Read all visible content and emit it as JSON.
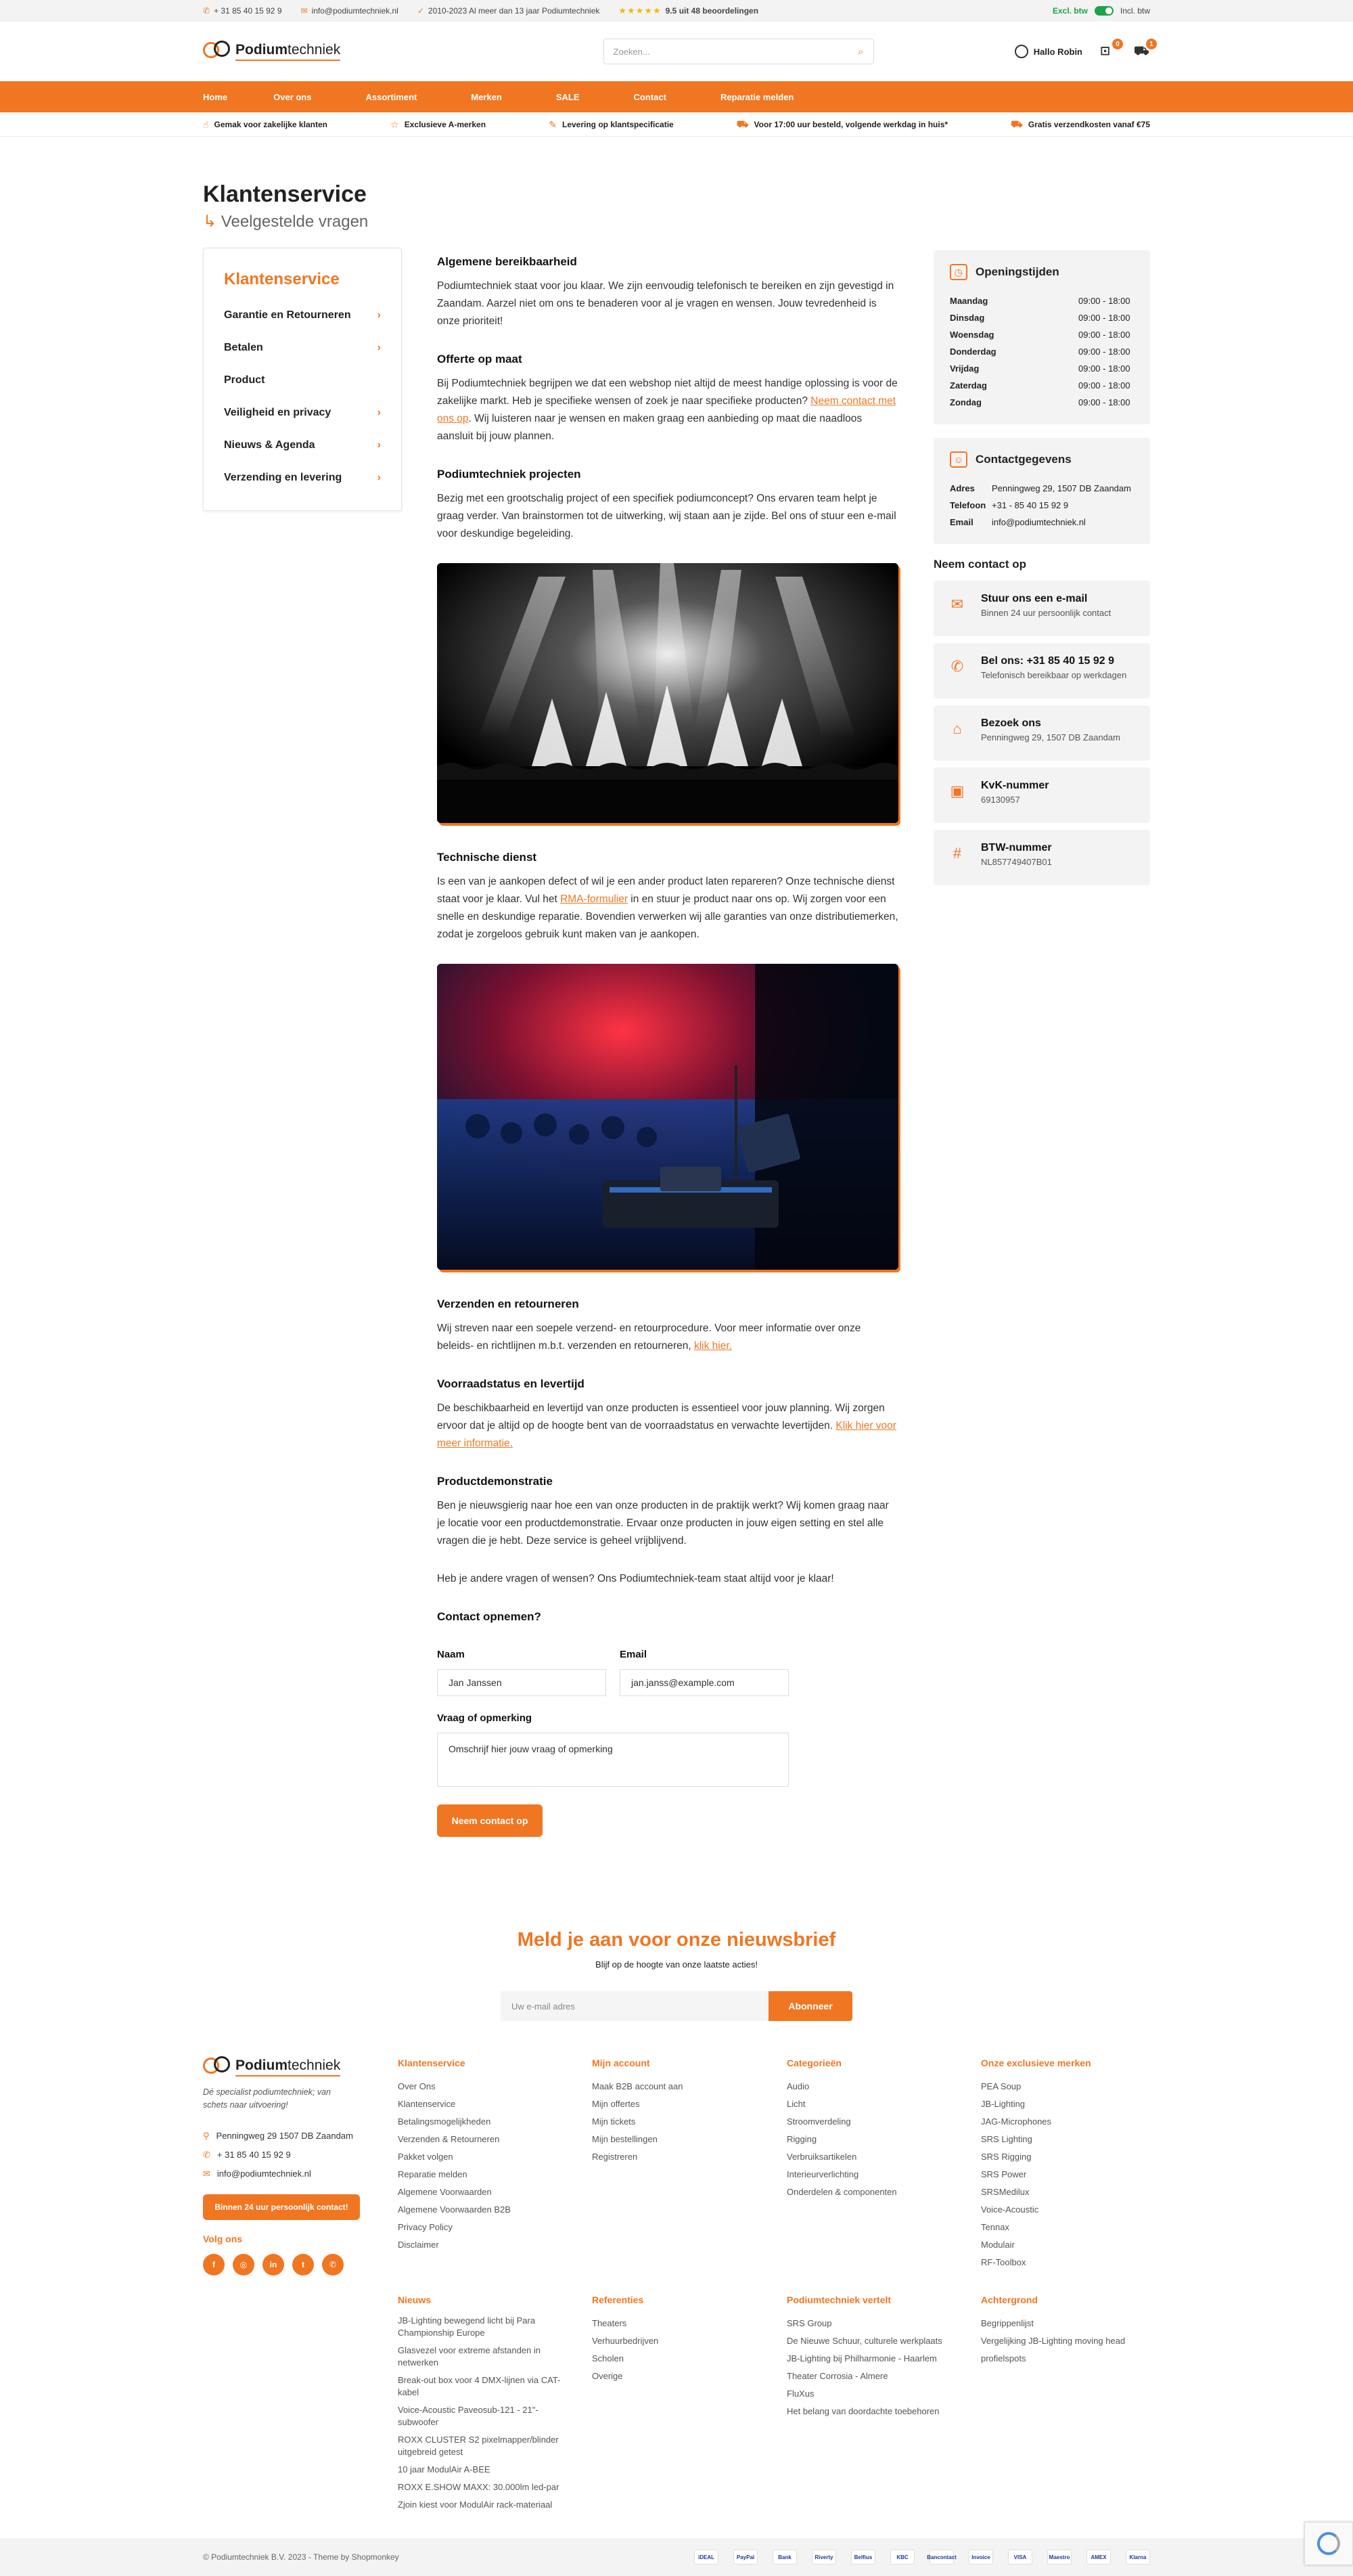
{
  "topbar": {
    "phone": "+ 31 85 40 15 92 9",
    "email": "info@podiumtechniek.nl",
    "experience": "2010-2023 Al meer dan 13 jaar Podiumtechniek",
    "rating": "9.5 uit 48 beoordelingen",
    "excl": "Excl. btw",
    "incl": "Incl. btw"
  },
  "header": {
    "logo_bold": "Podium",
    "logo_light": "techniek",
    "search_placeholder": "Zoeken...",
    "user": "Hallo Robin",
    "wishlist_count": "0",
    "cart_count": "1"
  },
  "nav": [
    "Home",
    "Over ons",
    "Assortiment",
    "Merken",
    "SALE",
    "Contact",
    "Reparatie melden"
  ],
  "usps": [
    "Gemak voor zakelijke klanten",
    "Exclusieve A-merken",
    "Levering op klantspecificatie",
    "Voor 17:00 uur besteld, volgende werkdag in huis*",
    "Gratis verzendkosten vanaf €75"
  ],
  "page": {
    "title": "Klantenservice",
    "subtitle": "Veelgestelde vragen"
  },
  "sidebar": {
    "title": "Klantenservice",
    "items": [
      "Garantie en Retourneren",
      "Betalen",
      "Product",
      "Veiligheid en privacy",
      "Nieuws & Agenda",
      "Verzending en levering"
    ]
  },
  "content": {
    "s1_title": "Algemene bereikbaarheid",
    "s1_text": "Podiumtechniek staat voor jou klaar. We zijn eenvoudig telefonisch te bereiken en zijn gevestigd in Zaandam. Aarzel niet om ons te benaderen voor al je vragen en wensen. Jouw tevredenheid is onze prioriteit!",
    "s2_title": "Offerte op maat",
    "s2_text_a": "Bij Podiumtechniek begrijpen we dat een webshop niet altijd de meest handige oplossing is voor de zakelijke markt. Heb je specifieke wensen of zoek je naar specifieke producten? ",
    "s2_link": "Neem contact met ons op",
    "s2_text_b": ". Wij luisteren naar je wensen en maken graag een aanbieding op maat die naadloos aansluit bij jouw plannen.",
    "s3_title": "Podiumtechniek projecten",
    "s3_text": "Bezig met een grootschalig project of een specifiek podiumconcept? Ons ervaren team helpt je graag verder. Van brainstormen tot de uitwerking, wij staan aan je zijde. Bel ons of stuur een e-mail voor deskundige begeleiding.",
    "s4_title": "Technische dienst",
    "s4_text_a": "Is een van je aankopen defect of wil je een ander product laten repareren? Onze technische dienst staat voor je klaar. Vul het ",
    "s4_link": "RMA-formulier",
    "s4_text_b": " in en stuur je product naar ons op. Wij zorgen voor een snelle en deskundige reparatie. Bovendien verwerken wij alle garanties van onze distributiemerken, zodat je zorgeloos gebruik kunt maken van je aankopen.",
    "s5_title": "Verzenden en retourneren",
    "s5_text": "Wij streven naar een soepele verzend- en retourprocedure. Voor meer informatie over onze beleids- en richtlijnen m.b.t. verzenden en retourneren, ",
    "s5_link": "klik hier.",
    "s6_title": "Voorraadstatus en levertijd",
    "s6_text": "De beschikbaarheid en levertijd van onze producten is essentieel voor jouw planning. Wij zorgen ervoor dat je altijd op de hoogte bent van de voorraadstatus en verwachte levertijden. ",
    "s6_link": "Klik hier voor meer informatie.",
    "s7_title": "Productdemonstratie",
    "s7_text": "Ben je nieuwsgierig naar hoe een van onze producten in de praktijk werkt? Wij komen graag naar je locatie voor een productdemonstratie. Ervaar onze producten in jouw eigen setting en stel alle vragen die je hebt. Deze service is geheel vrijblijvend.",
    "closing": "Heb je andere vragen of wensen? Ons Podiumtechniek-team staat altijd voor je klaar!"
  },
  "form": {
    "title": "Contact opnemen?",
    "name_label": "Naam",
    "name_value": "Jan Janssen",
    "email_label": "Email",
    "email_value": "jan.janss@example.com",
    "question_label": "Vraag of opmerking",
    "question_placeholder": "Omschrijf hier jouw vraag of opmerking",
    "submit": "Neem contact op"
  },
  "hours": {
    "title": "Openingstijden",
    "rows": [
      {
        "day": "Maandag",
        "time": "09:00 - 18:00"
      },
      {
        "day": "Dinsdag",
        "time": "09:00 - 18:00"
      },
      {
        "day": "Woensdag",
        "time": "09:00 - 18:00"
      },
      {
        "day": "Donderdag",
        "time": "09:00 - 18:00"
      },
      {
        "day": "Vrijdag",
        "time": "09:00 - 18:00"
      },
      {
        "day": "Zaterdag",
        "time": "09:00 - 18:00"
      },
      {
        "day": "Zondag",
        "time": "09:00 - 18:00"
      }
    ]
  },
  "contact_details": {
    "title": "Contactgegevens",
    "rows": [
      {
        "k": "Adres",
        "v": "Penningweg 29, 1507 DB Zaandam"
      },
      {
        "k": "Telefoon",
        "v": "+31 - 85 40 15 92 9"
      },
      {
        "k": "Email",
        "v": "info@podiumtechniek.nl"
      }
    ]
  },
  "contact_us": {
    "title": "Neem contact op",
    "items": [
      {
        "icon": "mail-icon",
        "glyph": "✉",
        "t": "Stuur ons een e-mail",
        "s": "Binnen 24 uur persoonlijk contact"
      },
      {
        "icon": "phone-icon",
        "glyph": "✆",
        "t": "Bel ons: +31 85 40 15 92 9",
        "s": "Telefonisch bereikbaar op werkdagen"
      },
      {
        "icon": "store-icon",
        "glyph": "⌂",
        "t": "Bezoek ons",
        "s": "Penningweg 29, 1507 DB Zaandam"
      },
      {
        "icon": "document-icon",
        "glyph": "▣",
        "t": "KvK-nummer",
        "s": "69130957"
      },
      {
        "icon": "hash-icon",
        "glyph": "#",
        "t": "BTW-nummer",
        "s": "NL857749407B01"
      }
    ]
  },
  "newsletter": {
    "title": "Meld je aan voor onze nieuwsbrief",
    "sub": "Blijf op de hoogte van onze laatste acties!",
    "placeholder": "Uw e-mail adres",
    "button": "Abonneer"
  },
  "footer": {
    "tagline": "Dé specialist podiumtechniek; van schets naar uitvoering!",
    "address": "Penningweg 29  1507 DB Zaandam",
    "phone": "+ 31 85 40 15 92 9",
    "email": "info@podiumtechniek.nl",
    "cta": "Binnen 24 uur persoonlijk contact!",
    "follow": "Volg ons",
    "cols": [
      {
        "h": "Klantenservice",
        "links": [
          "Over Ons",
          "Klantenservice",
          "Betalingsmogelijkheden",
          "Verzenden & Retourneren",
          "Pakket volgen",
          "Reparatie melden",
          "Algemene Voorwaarden",
          "Algemene Voorwaarden B2B",
          "Privacy Policy",
          "Disclaimer"
        ]
      },
      {
        "h": "Mijn account",
        "links": [
          "Maak B2B account aan",
          "Mijn offertes",
          "Mijn tickets",
          "Mijn bestellingen",
          "Registreren"
        ]
      },
      {
        "h": "Categorieën",
        "links": [
          "Audio",
          "Licht",
          "Stroomverdeling",
          "Rigging",
          "Verbruiksartikelen",
          "Interieurverlichting",
          "Onderdelen & componenten"
        ]
      },
      {
        "h": "Onze exclusieve merken",
        "links": [
          "PEA Soup",
          "JB-Lighting",
          "JAG-Microphones",
          "SRS Lighting",
          "SRS Rigging",
          "SRS Power",
          "SRSMedilux",
          "Voice-Acoustic",
          "Tennax",
          "Modulair",
          "RF-Toolbox"
        ]
      },
      {
        "h": "Nieuws",
        "links": [
          "JB-Lighting bewegend licht bij Para Championship Europe",
          "Glasvezel voor extreme afstanden in netwerken",
          "Break-out box voor 4 DMX-lijnen via CAT-kabel",
          "Voice-Acoustic Paveosub-121 - 21\"-subwoofer",
          "ROXX CLUSTER S2 pixelmapper/blinder uitgebreid getest",
          "10 jaar ModulAir A-BEE",
          "ROXX E.SHOW MAXX: 30.000lm led-par",
          "Zjoin kiest voor ModulAir rack-materiaal"
        ]
      },
      {
        "h": "Referenties",
        "links": [
          "Theaters",
          "Verhuurbedrijven",
          "Scholen",
          "Overige"
        ]
      },
      {
        "h": "Podiumtechniek vertelt",
        "links": [
          "SRS Group",
          "De Nieuwe Schuur, culturele werkplaats",
          "JB-Lighting bij Philharmonie - Haarlem",
          "Theater Corrosia - Almere",
          "FluXus",
          "Het belang van doordachte toebehoren"
        ]
      },
      {
        "h": "Achtergrond",
        "links": [
          "Begrippenlijst",
          "Vergelijking JB-Lighting moving head profielspots"
        ]
      }
    ],
    "copyright": "© Podiumtechniek B.V. 2023 - Theme by Shopmonkey",
    "payments": [
      "iDEAL",
      "PayPal",
      "Bank",
      "Riverty",
      "Belfius",
      "KBC",
      "Bancontact",
      "Invoice",
      "VISA",
      "Maestro",
      "AMEX",
      "Klarna"
    ]
  }
}
